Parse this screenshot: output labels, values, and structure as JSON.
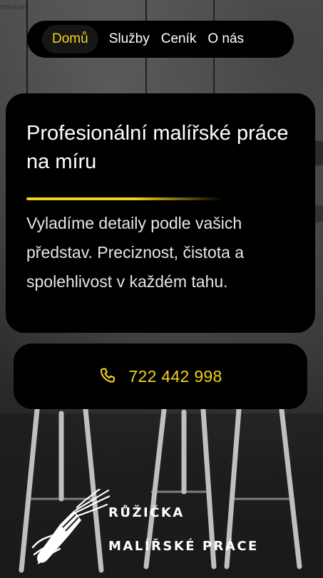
{
  "page": {
    "corner_label": "navbar"
  },
  "nav": {
    "items": [
      {
        "label": "Domů",
        "active": true
      },
      {
        "label": "Služby",
        "active": false
      },
      {
        "label": "Ceník",
        "active": false
      },
      {
        "label": "O nás",
        "active": false
      }
    ]
  },
  "hero": {
    "title": "Profesionální malířské práce na míru",
    "description": "Vyladíme detaily podle vašich představ. Preciznost, čistota a spolehlivost v každém tahu."
  },
  "contact": {
    "phone_icon": "phone-icon",
    "phone_number": "722 442 998"
  },
  "logo": {
    "icon": "paintbrush-icon",
    "line1": "RŮŽIČKA",
    "line2": "MALÍŘSKÉ PRÁCE"
  },
  "colors": {
    "accent": "#f3d21c",
    "card_bg": "#000000",
    "text": "#ffffff"
  }
}
